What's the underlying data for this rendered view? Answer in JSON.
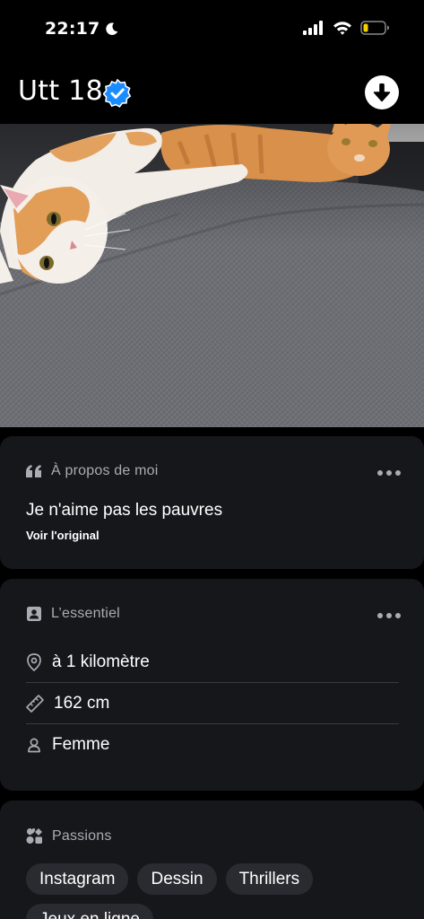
{
  "status_bar": {
    "time": "22:17",
    "icons": [
      "moon-icon",
      "cellular-signal-icon",
      "wifi-icon",
      "battery-low-icon"
    ],
    "battery_color": "#f5d000"
  },
  "header": {
    "name": "Utt",
    "age": "18",
    "verified_color": "#1a8cff"
  },
  "photo": {
    "subject": "two-cats-on-grey-blanket"
  },
  "about": {
    "title": "À propos de moi",
    "text": "Je n'aime pas les pauvres",
    "see_original": "Voir l'original"
  },
  "basics": {
    "title": "L’essentiel",
    "distance": "à 1 kilomètre",
    "height": "162 cm",
    "gender": "Femme"
  },
  "passions": {
    "title": "Passions",
    "items": [
      "Instagram",
      "Dessin",
      "Thrillers",
      "Jeux en ligne"
    ]
  }
}
